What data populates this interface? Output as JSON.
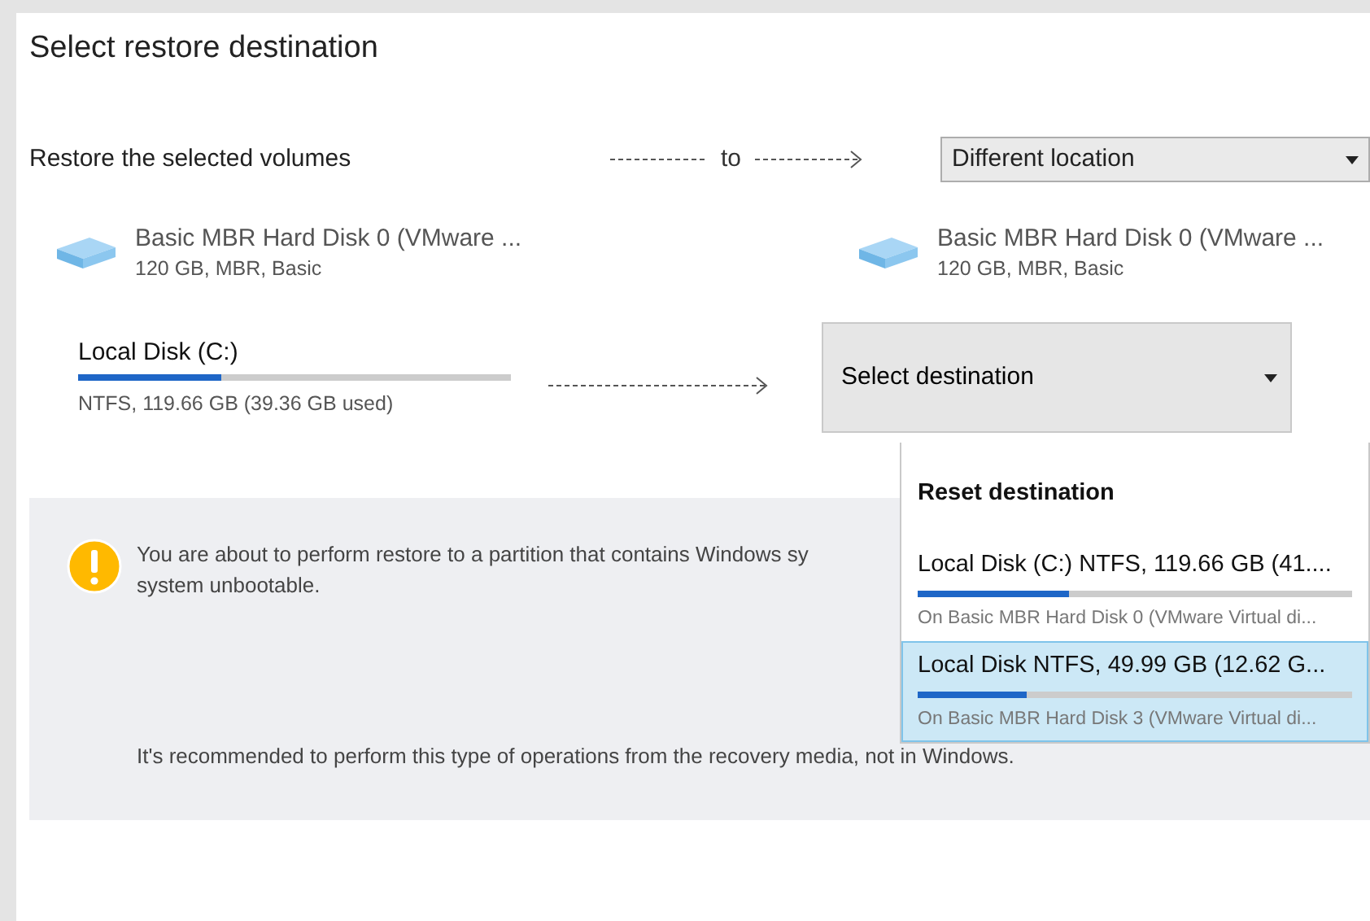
{
  "dialog": {
    "title": "Select restore destination"
  },
  "restore_row": {
    "label": "Restore the selected volumes",
    "connector": "to",
    "location": {
      "value": "Different location"
    }
  },
  "source_disk": {
    "name": "Basic MBR Hard Disk 0 (VMware ...",
    "details": "120 GB, MBR, Basic"
  },
  "target_disk": {
    "name": "Basic MBR Hard Disk 0 (VMware ...",
    "details": "120 GB, MBR, Basic"
  },
  "volume": {
    "name": "Local Disk (C:)",
    "level": 0.33,
    "details": "NTFS, 119.66 GB (39.36 GB used)"
  },
  "destination": {
    "value": "Select destination",
    "expanded": true,
    "options": [
      {
        "kind": "action",
        "label": "Reset destination",
        "selected": false
      },
      {
        "kind": "volume",
        "label": "Local Disk (C:) NTFS, 119.66 GB (41....",
        "level": 0.35,
        "details": "On Basic MBR Hard Disk 0 (VMware Virtual di...",
        "selected": false
      },
      {
        "kind": "volume",
        "label": "Local Disk NTFS, 49.99 GB (12.62 G...",
        "level": 0.25,
        "details": "On Basic MBR Hard Disk 3 (VMware Virtual di...",
        "selected": true
      }
    ]
  },
  "warning": {
    "lines": [
      "You are about to perform restore to a partition that contains Windows sy",
      "system unbootable."
    ],
    "note": "It's recommended to perform this type of operations from the recovery media, not in Windows."
  }
}
